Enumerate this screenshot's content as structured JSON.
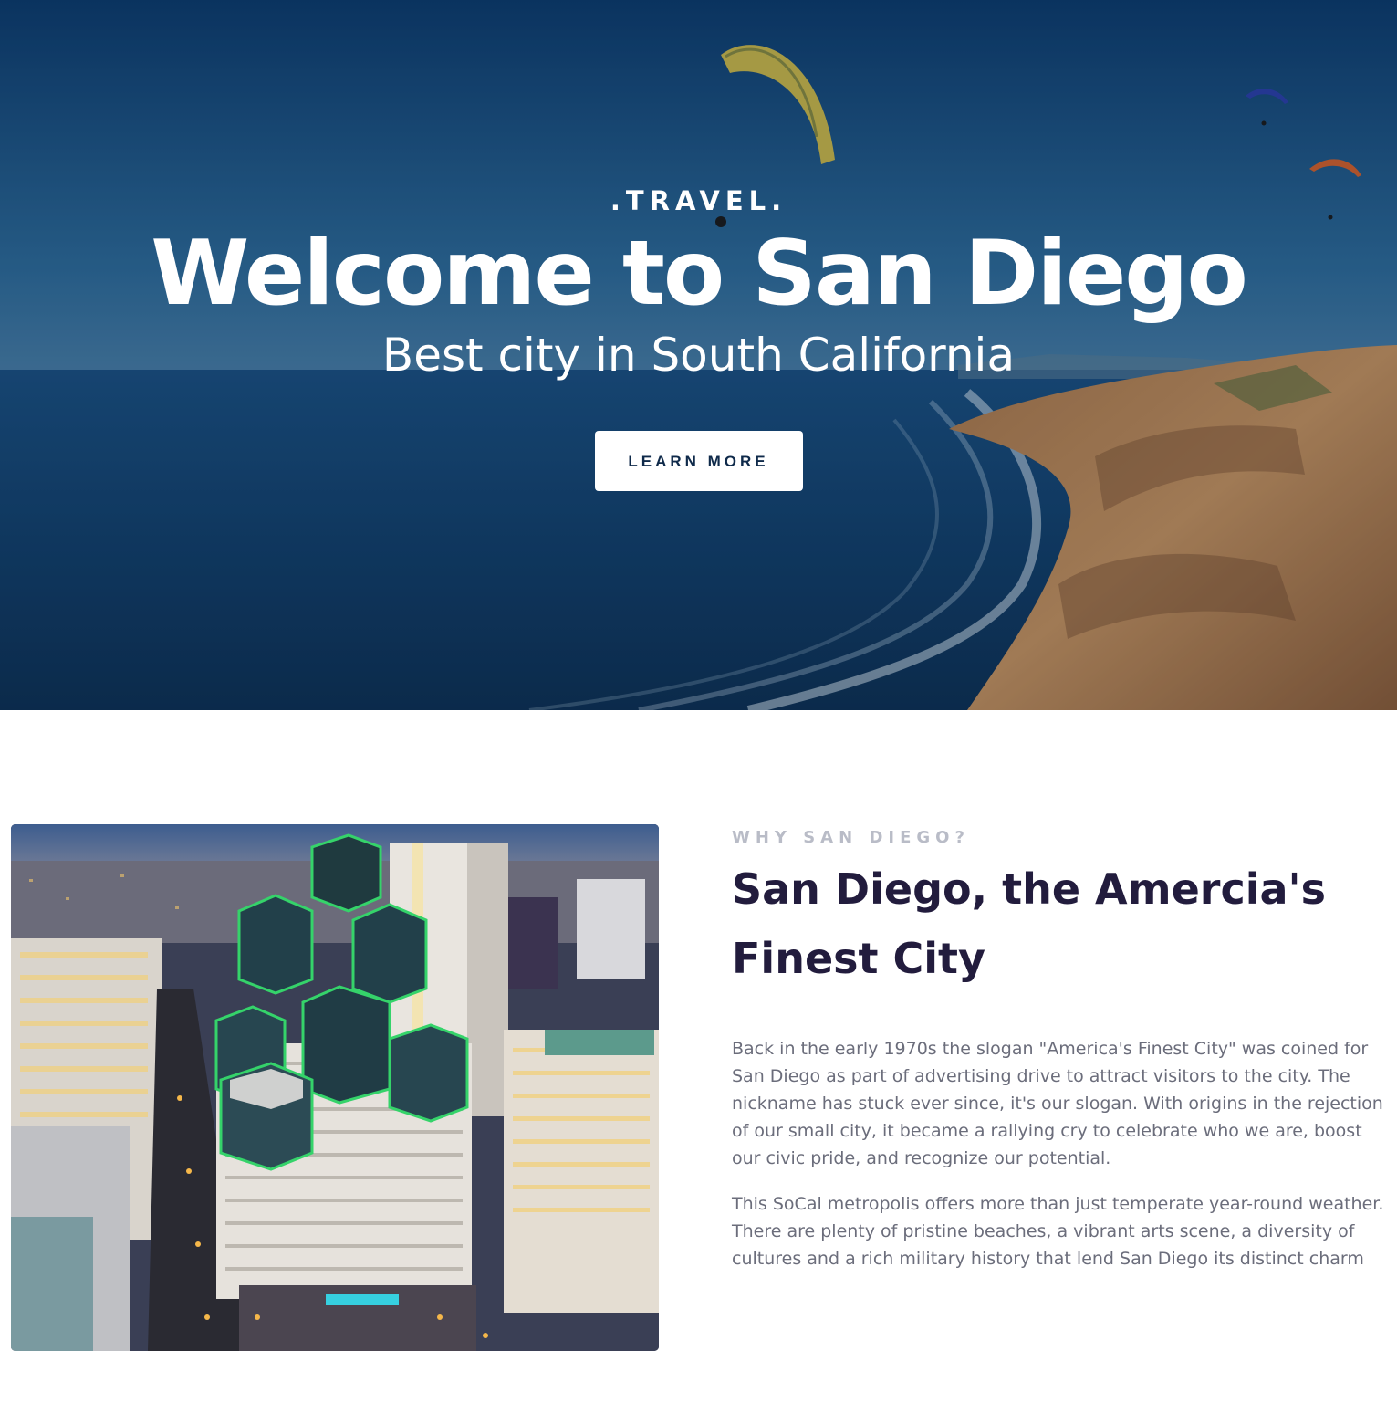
{
  "hero": {
    "eyebrow": ".TRAVEL.",
    "title": "Welcome to San Diego",
    "subtitle": "Best city in South California",
    "cta_label": "LEARN MORE"
  },
  "about": {
    "kicker": "WHY SAN DIEGO?",
    "heading_line1": "San Diego, the Amercia's",
    "heading_line2": "Finest City",
    "paragraph1": "Back in the early 1970s the slogan \"America's Finest City\" was coined for San Diego as part of advertising drive to attract visitors to the city. The nickname has stuck ever since, it's our slogan. With origins in the rejection of our small city, it became a rallying cry to celebrate who we are, boost our civic pride, and recognize our potential.",
    "paragraph2": "This SoCal metropolis offers more than just temperate year-round weather. There are plenty of pristine beaches, a vibrant arts scene, a diversity of cultures and a rich military history that lend San Diego its distinct charm"
  },
  "colors": {
    "heading": "#221c3d",
    "body_text": "#6b6d7b",
    "kicker": "#b9bcc7",
    "cta_text": "#0f2a4a",
    "cta_bg": "#ffffff"
  }
}
